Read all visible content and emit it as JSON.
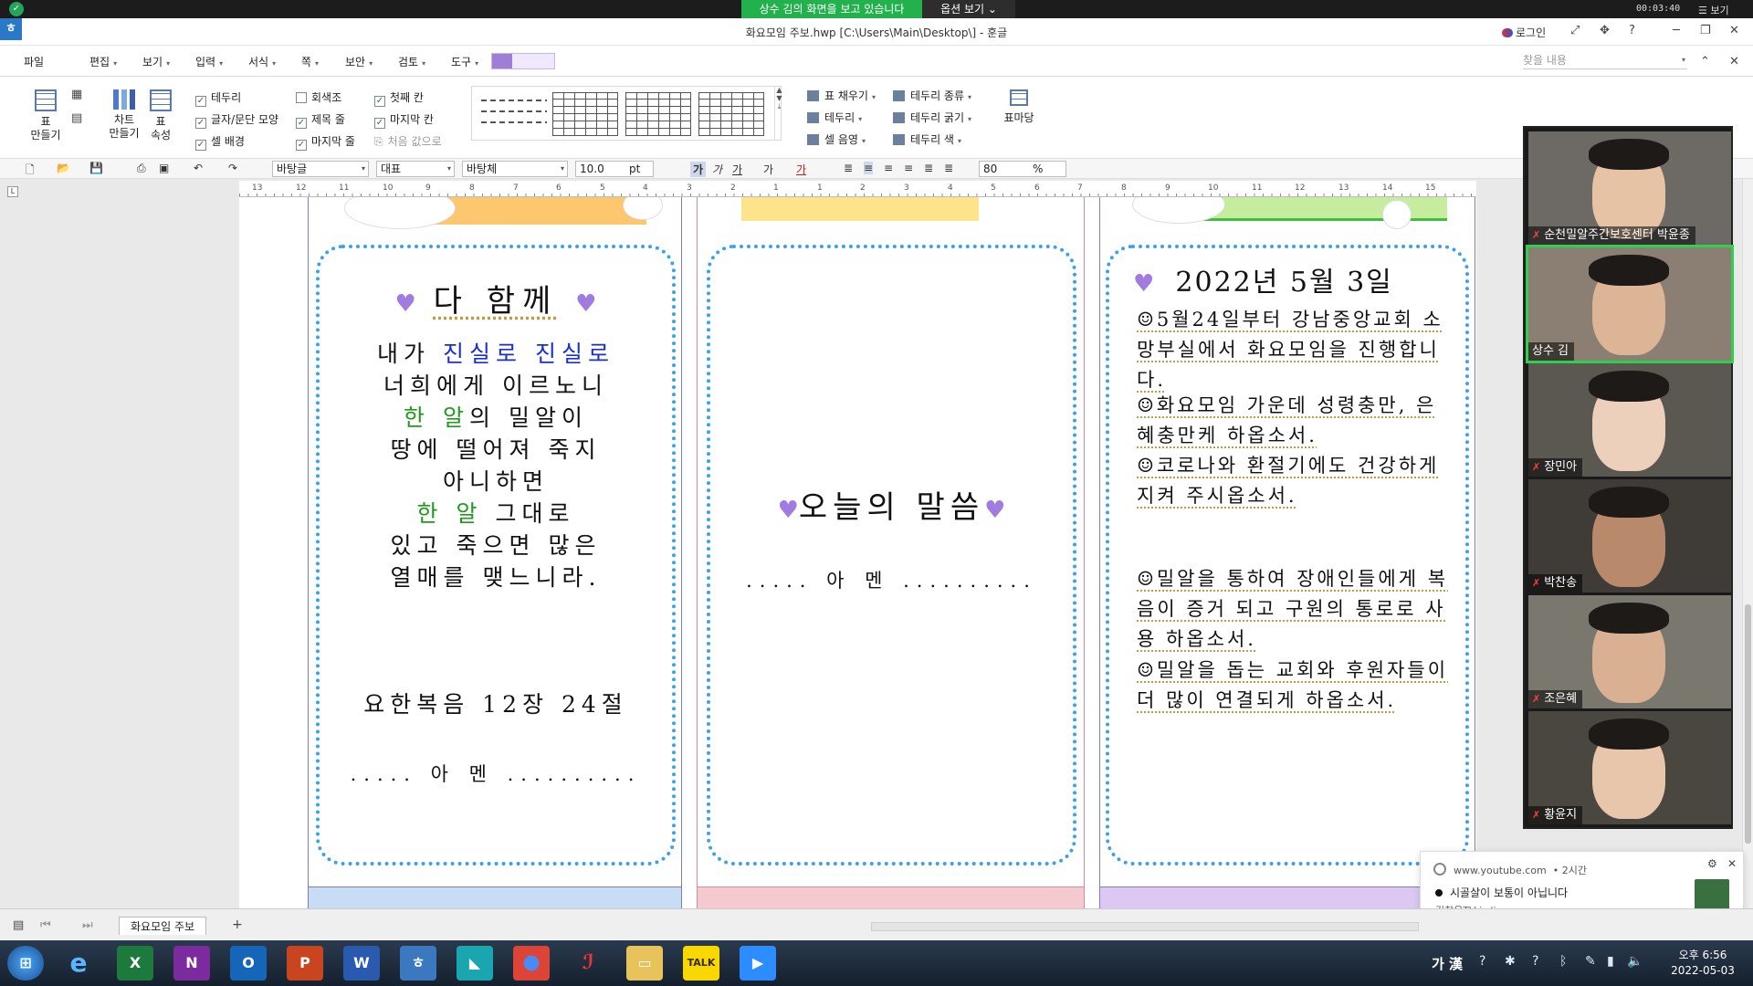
{
  "share_bar": {
    "status": "상수 김의 화면을 보고 있습니다",
    "options": "옵션 보기",
    "timer": "00:03:40",
    "more": "보기"
  },
  "titlebar": {
    "title": "화요모임 주보.hwp [C:\\Users\\Main\\Desktop\\] - 훈글",
    "login": "로그인"
  },
  "menu": {
    "items": [
      "파일",
      "편집",
      "보기",
      "입력",
      "서식",
      "쪽",
      "보안",
      "검토",
      "도구"
    ],
    "find_placeholder": "찾을 내용"
  },
  "ribbon": {
    "table_make": "표\n만들기",
    "chart_make": "차트\n만들기",
    "table_props": "표\n속성",
    "checks": [
      {
        "label": "테두리",
        "checked": true
      },
      {
        "label": "글자/문단 모양",
        "checked": true
      },
      {
        "label": "셀 배경",
        "checked": true
      },
      {
        "label": "회색조",
        "checked": false
      },
      {
        "label": "제목 줄",
        "checked": true
      },
      {
        "label": "마지막 줄",
        "checked": true
      },
      {
        "label": "첫째 칸",
        "checked": true
      },
      {
        "label": "마지막 칸",
        "checked": true
      },
      {
        "label": "처음 값으로",
        "checked": false
      }
    ],
    "right": {
      "fill": "표 채우기",
      "border": "테두리",
      "cell_shade": "셀 음영",
      "border_type": "테두리 종류",
      "border_width": "테두리 굵기",
      "border_color": "테두리 색",
      "table_pattern": "표마당"
    }
  },
  "format_bar": {
    "style": "바탕글",
    "lang": "대표",
    "font": "바탕체",
    "size": "10.0",
    "unit": "pt",
    "zoom": "80",
    "zoom_unit": "%"
  },
  "ruler": {
    "ticks": [
      "13",
      "12",
      "11",
      "10",
      "9",
      "8",
      "7",
      "6",
      "5",
      "4",
      "3",
      "2",
      "1",
      "1",
      "2",
      "3",
      "4",
      "5",
      "6",
      "7",
      "8",
      "9",
      "10",
      "11",
      "12",
      "13",
      "14",
      "15"
    ]
  },
  "document": {
    "panel1": {
      "heading": "다 함께",
      "verse": [
        [
          {
            "t": "내가 ",
            "c": ""
          },
          {
            "t": "진실로 진실로",
            "c": "blue"
          }
        ],
        [
          {
            "t": "너희에게 이르노니",
            "c": ""
          }
        ],
        [
          {
            "t": "한 알",
            "c": "green"
          },
          {
            "t": "의 밀알이",
            "c": ""
          }
        ],
        [
          {
            "t": "땅에 떨어져 죽지",
            "c": ""
          }
        ],
        [
          {
            "t": "아니하면",
            "c": ""
          }
        ],
        [
          {
            "t": "한 알",
            "c": "green"
          },
          {
            "t": " 그대로",
            "c": ""
          }
        ],
        [
          {
            "t": "있고 죽으면 많은",
            "c": ""
          }
        ],
        [
          {
            "t": "열매를 맺느니라.",
            "c": ""
          }
        ]
      ],
      "reference": "요한복음 12장 24절",
      "amen": "..... 아 멘 .........."
    },
    "panel2": {
      "heading": "오늘의 말씀",
      "amen": "..... 아 멘 .........."
    },
    "panel3": {
      "date": "2022년 5월 3일",
      "items": [
        "☺5월24일부터 강남중앙교회 소망부실에서 화요모임을 진행합니다.",
        "☺화요모임 가운데 성령충만, 은혜충만케 하옵소서.",
        "☺코로나와 환절기에도 건강하게 지켜 주시옵소서.",
        "☺밀알을 통하여 장애인들에게 복음이 증거 되고 구원의 통로로 사용 하옵소서.",
        "☺밀알을 돕는 교회와 후원자들이 더 많이 연결되게 하옵소서."
      ]
    }
  },
  "participants": [
    {
      "name": "순천밀알주간보호센터 박윤종",
      "muted": true,
      "active": false
    },
    {
      "name": "상수 김",
      "muted": false,
      "active": true
    },
    {
      "name": "장민아",
      "muted": true,
      "active": false
    },
    {
      "name": "박찬송",
      "muted": true,
      "active": false
    },
    {
      "name": "조은혜",
      "muted": true,
      "active": false
    },
    {
      "name": "황윤지",
      "muted": true,
      "active": false
    }
  ],
  "notification": {
    "source": "www.youtube.com",
    "time": "• 2시간",
    "message": "시골살이 보통이 아닙니다",
    "sub": "김창옥TV is live"
  },
  "tabs": {
    "sheet": "화요모임 주보"
  },
  "taskbar": {
    "ime": "가 漢",
    "time": "오후 6:56",
    "date": "2022-05-03"
  },
  "colors": {
    "zoom_green": "#22b14c",
    "dot_border": "#3aa2e8",
    "heart": "#a07be0",
    "verse_blue": "#1a2fd0",
    "verse_green": "#1f9a1f"
  }
}
